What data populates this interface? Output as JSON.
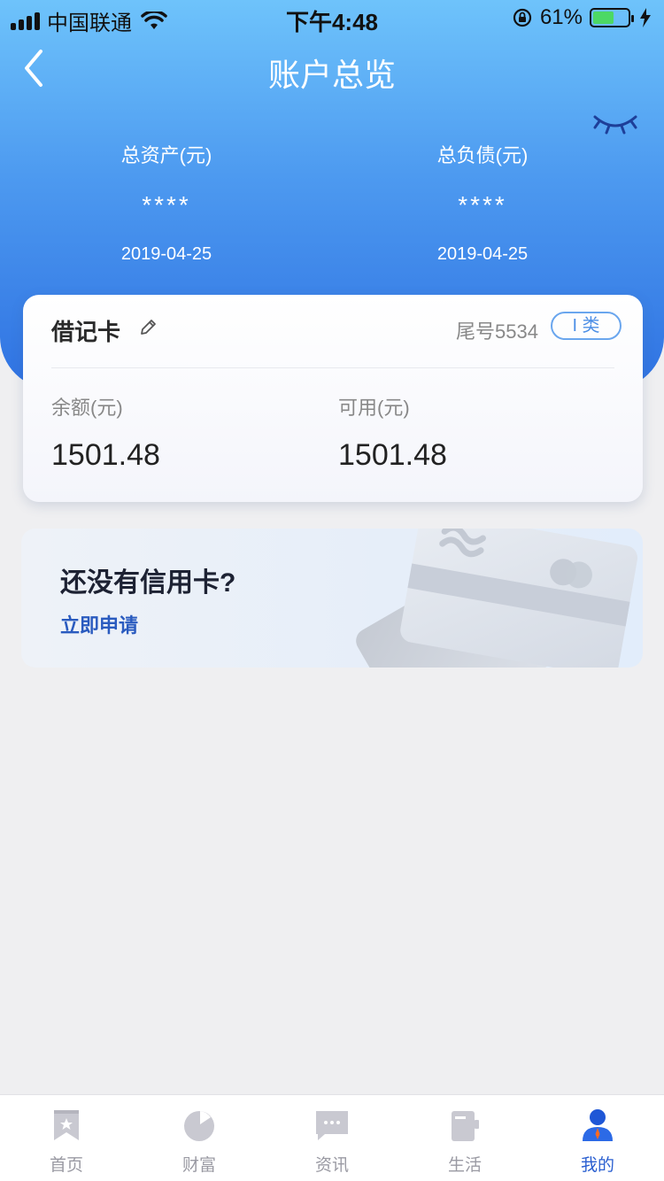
{
  "status_bar": {
    "carrier": "中国联通",
    "time": "下午4:48",
    "battery": "61%",
    "battery_level": 0.61
  },
  "header": {
    "title": "账户总览",
    "total_assets_label": "总资产(元)",
    "total_assets_value": "****",
    "total_assets_date": "2019-04-25",
    "total_liabilities_label": "总负债(元)",
    "total_liabilities_value": "****",
    "total_liabilities_date": "2019-04-25"
  },
  "debit_card": {
    "title": "借记卡",
    "tail_number": "尾号5534",
    "class_badge": "I 类",
    "balance_label": "余额(元)",
    "balance_value": "1501.48",
    "available_label": "可用(元)",
    "available_value": "1501.48"
  },
  "credit_promo": {
    "title": "还没有信用卡?",
    "apply_link": "立即申请"
  },
  "tabbar": {
    "items": [
      {
        "label": "首页",
        "icon": "home-bookmark-icon"
      },
      {
        "label": "财富",
        "icon": "pie-chart-icon"
      },
      {
        "label": "资讯",
        "icon": "message-icon"
      },
      {
        "label": "生活",
        "icon": "cup-icon"
      },
      {
        "label": "我的",
        "icon": "user-icon"
      }
    ],
    "active_index": 4,
    "active_color": "#2a5fd0",
    "inactive_color": "#c9c9d1"
  },
  "colors": {
    "header_top": "#6ec3fb",
    "header_bottom": "#2f72e2",
    "background": "#efeff1"
  }
}
